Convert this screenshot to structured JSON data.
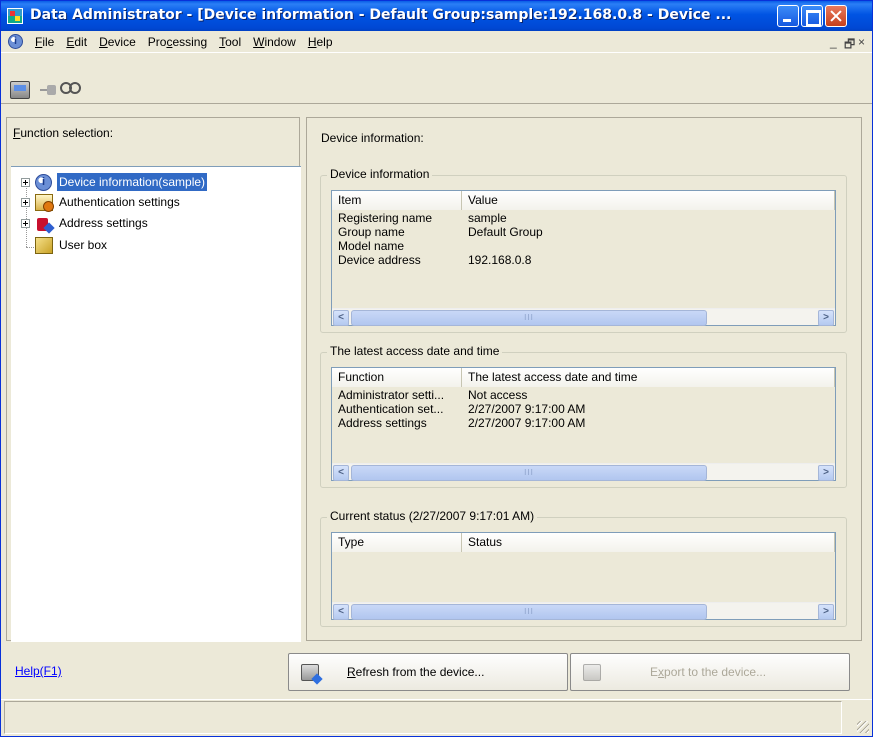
{
  "window": {
    "title": "Data Administrator - [Device information - Default Group:sample:192.168.0.8 - Device ..."
  },
  "menu": {
    "items": [
      {
        "ul": "F",
        "rest": "ile"
      },
      {
        "ul": "E",
        "rest": "dit"
      },
      {
        "ul": "D",
        "rest": "evice"
      },
      {
        "pre": "Pro",
        "ul": "c",
        "rest": "essing"
      },
      {
        "ul": "T",
        "rest": "ool"
      },
      {
        "ul": "W",
        "rest": "indow"
      },
      {
        "ul": "H",
        "rest": "elp"
      }
    ],
    "mdi": {
      "min": "_",
      "restore": "🗗",
      "close": "×"
    }
  },
  "left": {
    "label_ul": "F",
    "label_rest": "unction selection:",
    "tree": [
      {
        "label": "Device information(sample)",
        "selected": true,
        "icon": "info-icon"
      },
      {
        "label": "Authentication settings",
        "icon": "authentication-icon"
      },
      {
        "label": "Address settings",
        "icon": "address-book-icon"
      },
      {
        "label": "User box",
        "icon": "user-box-icon"
      }
    ]
  },
  "right": {
    "title": "Device information:",
    "device_info": {
      "label": "Device information",
      "columns": [
        "Item",
        "Value"
      ],
      "rows": [
        [
          "Registering name",
          "sample"
        ],
        [
          "Group name",
          "Default Group"
        ],
        [
          "Model name",
          ""
        ],
        [
          "Device address",
          "192.168.0.8"
        ]
      ]
    },
    "latest_access": {
      "label": "The latest access date and time",
      "columns": [
        "Function",
        "The latest access date and time"
      ],
      "rows": [
        [
          "Administrator setti...",
          "Not access"
        ],
        [
          "Authentication set...",
          "2/27/2007 9:17:00 AM"
        ],
        [
          "Address settings",
          "2/27/2007 9:17:00 AM"
        ]
      ]
    },
    "current_status": {
      "label": "Current status (2/27/2007 9:17:01 AM)",
      "columns": [
        "Type",
        "Status"
      ],
      "rows": []
    },
    "scroll_arrows": {
      "left": "<",
      "right": ">",
      "grip": "III"
    }
  },
  "bottom": {
    "help": "Help(F1)",
    "refresh_ul": "R",
    "refresh_rest": "efresh from the device...",
    "export_pre": "E",
    "export_ul": "x",
    "export_rest": "port to the device..."
  }
}
